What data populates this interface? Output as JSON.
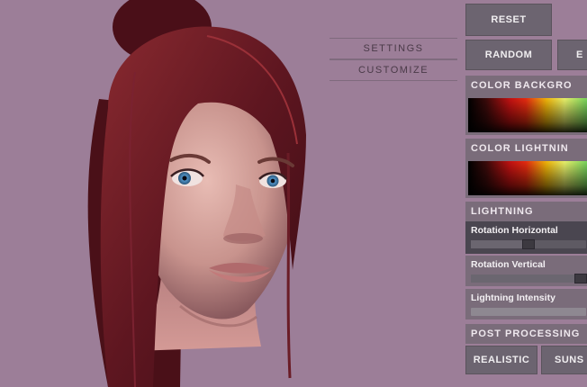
{
  "nav": {
    "settings_label": "SETTINGS",
    "customize_label": "CUSTOMIZE"
  },
  "buttons": {
    "reset_label": "RESET",
    "random_label": "RANDOM",
    "extra_label": "E"
  },
  "sections": {
    "color_background": "COLOR BACKGRO",
    "color_lightning": "COLOR LIGHTNIN",
    "lightning": "LIGHTNING",
    "post_processing": "POST PROCESSING"
  },
  "sliders": [
    {
      "label": "Rotation Horizontal",
      "value": 0.5
    },
    {
      "label": "Rotation Vertical",
      "value": 0.95
    },
    {
      "label": "Lightning Intensity",
      "value": 0.0
    }
  ],
  "post_processing_options": [
    {
      "label": "REALISTIC"
    },
    {
      "label": "SUNS"
    }
  ],
  "colors": {
    "background": "#9c7e98",
    "panel": "#7a6c7a",
    "button": "#6c6470",
    "hair": "#6a1c26",
    "skin": "#d8a4a0"
  }
}
